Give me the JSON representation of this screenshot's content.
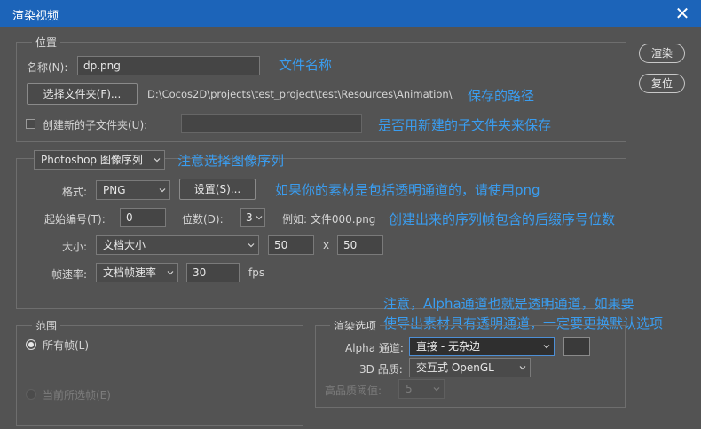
{
  "window": {
    "title": "渲染视频",
    "close_glyph": "✕"
  },
  "location": {
    "legend": "位置",
    "name_label": "名称(N):",
    "name_value": "dp.png",
    "choose_folder_button": "选择文件夹(F)...",
    "folder_path": "D:\\Cocos2D\\projects\\test_project\\test\\Resources\\Animation\\",
    "create_subfolder_label": "创建新的子文件夹(U):",
    "create_subfolder_checked": false,
    "subfolder_value": ""
  },
  "export": {
    "type_select": "Photoshop 图像序列",
    "format_label": "格式:",
    "format_value": "PNG",
    "settings_button": "设置(S)...",
    "start_number_label": "起始编号(T):",
    "start_number_value": "0",
    "digits_label": "位数(D):",
    "digits_value": "3",
    "example_text": "例如: 文件000.png",
    "size_label": "大小:",
    "size_select": "文档大小",
    "width_value": "50",
    "times_sign": "x",
    "height_value": "50",
    "frame_rate_label": "帧速率:",
    "frame_rate_select": "文档帧速率",
    "frame_rate_value": "30",
    "fps_unit": "fps"
  },
  "range": {
    "legend": "范围",
    "all_frames_label": "所有帧(L)",
    "current_frames_label": "当前所选帧(E)",
    "selected": "all_frames"
  },
  "render_options": {
    "legend": "渲染选项",
    "alpha_label": "Alpha 通道:",
    "alpha_value": "直接 - 无杂边",
    "quality_3d_label": "3D 品质:",
    "quality_3d_value": "交互式 OpenGL",
    "hq_threshold_label": "高品质阈值:",
    "hq_threshold_value": "5"
  },
  "buttons": {
    "render": "渲染",
    "reset": "复位"
  },
  "annotations": {
    "file_name": "文件名称",
    "save_path": "保存的路径",
    "subfolder": "是否用新建的子文件夹来保存",
    "choose_sequence": "注意选择图像序列",
    "use_png": "如果你的素材是包括透明通道的，请使用png",
    "digits_hint": "创建出来的序列帧包含的后缀序号位数",
    "alpha_note_line1": "注意，Alpha通道也就是透明通道，如果要",
    "alpha_note_line2": "使导出素材具有透明通道，一定要更换默认选项"
  },
  "colors": {
    "titlebar": "#1c64b9",
    "dialog_bg": "#535353",
    "annotation_blue": "#3a9df0",
    "text": "#d6d6d6",
    "disabled_text": "#7c7c7c"
  }
}
